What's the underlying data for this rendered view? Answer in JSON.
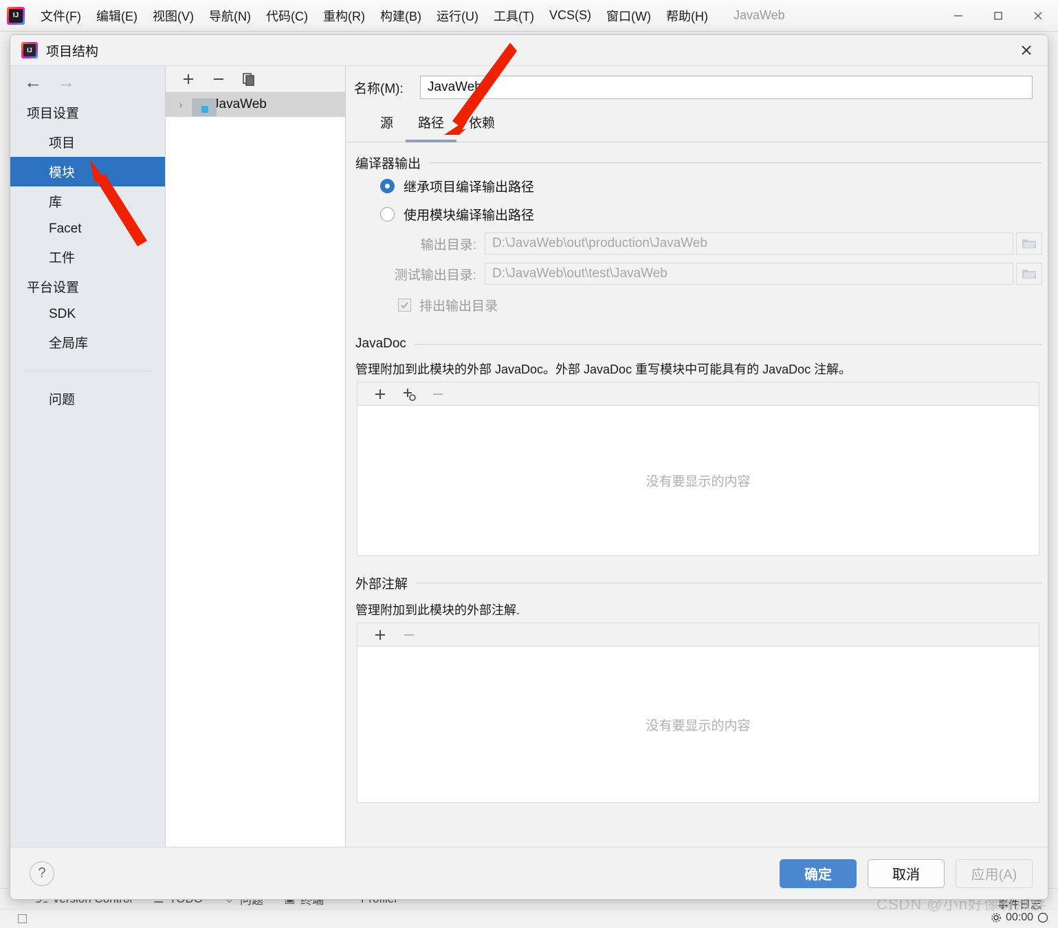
{
  "ide": {
    "logo_icon": "intellij-idea-logo",
    "menu": [
      {
        "label": "文件(F)"
      },
      {
        "label": "编辑(E)"
      },
      {
        "label": "视图(V)"
      },
      {
        "label": "导航(N)"
      },
      {
        "label": "代码(C)"
      },
      {
        "label": "重构(R)"
      },
      {
        "label": "构建(B)"
      },
      {
        "label": "运行(U)"
      },
      {
        "label": "工具(T)"
      },
      {
        "label": "VCS(S)"
      },
      {
        "label": "窗口(W)"
      },
      {
        "label": "帮助(H)"
      }
    ],
    "project_title": "JavaWeb",
    "window_controls": {
      "minimize": "—",
      "maximize": "□",
      "close": "✕"
    },
    "bottom_strip": [
      {
        "label": "Version Control",
        "icon": "branch-icon"
      },
      {
        "label": "TODO",
        "icon": "list-icon"
      },
      {
        "label": "问题",
        "icon": "shield-icon"
      },
      {
        "label": "终端",
        "icon": "terminal-icon"
      },
      {
        "label": "Profiler",
        "icon": "profiler-icon"
      }
    ],
    "float_time": "00:00",
    "float_label": "事件日志",
    "watermark": "CSDN @小n好像有点胖"
  },
  "dialog": {
    "title": "项目结构",
    "icon": "intellij-idea-logo",
    "close_label": "✕",
    "nav": {
      "back_icon": "←",
      "forward_icon": "→",
      "groups": [
        {
          "label": "项目设置",
          "items": [
            {
              "label": "项目",
              "selected": false
            },
            {
              "label": "模块",
              "selected": true
            },
            {
              "label": "库",
              "selected": false
            },
            {
              "label": "Facet",
              "selected": false
            },
            {
              "label": "工件",
              "selected": false
            }
          ]
        },
        {
          "label": "平台设置",
          "items": [
            {
              "label": "SDK",
              "selected": false
            },
            {
              "label": "全局库",
              "selected": false
            }
          ]
        }
      ],
      "extra": [
        {
          "label": "问题"
        }
      ]
    },
    "module_list": {
      "toolbar": [
        {
          "icon": "plus-icon",
          "glyph": "＋"
        },
        {
          "icon": "minus-icon",
          "glyph": "−"
        },
        {
          "icon": "copy-icon",
          "glyph": "⧉"
        }
      ],
      "rows": [
        {
          "name": "JavaWeb",
          "chevron": "›",
          "selected": true
        }
      ]
    },
    "name_field": {
      "label": "名称(M):",
      "value": "JavaWeb"
    },
    "tabs": [
      {
        "label": "源",
        "active": false
      },
      {
        "label": "路径",
        "active": true
      },
      {
        "label": "依赖",
        "active": false
      }
    ],
    "compiler_output": {
      "title": "编译器输出",
      "radios": [
        {
          "label": "继承项目编译输出路径",
          "checked": true
        },
        {
          "label": "使用模块编译输出路径",
          "checked": false
        }
      ],
      "fields": [
        {
          "label": "输出目录:",
          "value": "D:\\JavaWeb\\out\\production\\JavaWeb",
          "browse_icon": "folder-icon"
        },
        {
          "label": "测试输出目录:",
          "value": "D:\\JavaWeb\\out\\test\\JavaWeb",
          "browse_icon": "folder-icon"
        }
      ],
      "checkbox": {
        "label": "排出输出目录",
        "checked": true,
        "glyph": "✓"
      }
    },
    "javadoc": {
      "title": "JavaDoc",
      "description": "管理附加到此模块的外部 JavaDoc。外部 JavaDoc 重写模块中可能具有的 JavaDoc 注解。",
      "toolbar": [
        {
          "icon": "plus-icon",
          "glyph": "＋"
        },
        {
          "icon": "plus-url-icon",
          "glyph": "＋"
        },
        {
          "icon": "minus-icon",
          "glyph": "−"
        }
      ],
      "empty_text": "没有要显示的内容"
    },
    "external_annotations": {
      "title": "外部注解",
      "description": "管理附加到此模块的外部注解.",
      "toolbar": [
        {
          "icon": "plus-icon",
          "glyph": "＋"
        },
        {
          "icon": "minus-icon",
          "glyph": "−"
        }
      ],
      "empty_text": "没有要显示的内容"
    },
    "footer": {
      "help_label": "?",
      "ok_label": "确定",
      "cancel_label": "取消",
      "apply_label": "应用(A)"
    }
  },
  "colors": {
    "accent": "#2c72c0",
    "primary_button": "#4a87cf",
    "annotation_arrow": "#ee2200",
    "dialog_bg": "#f2f2f2",
    "nav_bg": "#e6eaee"
  }
}
